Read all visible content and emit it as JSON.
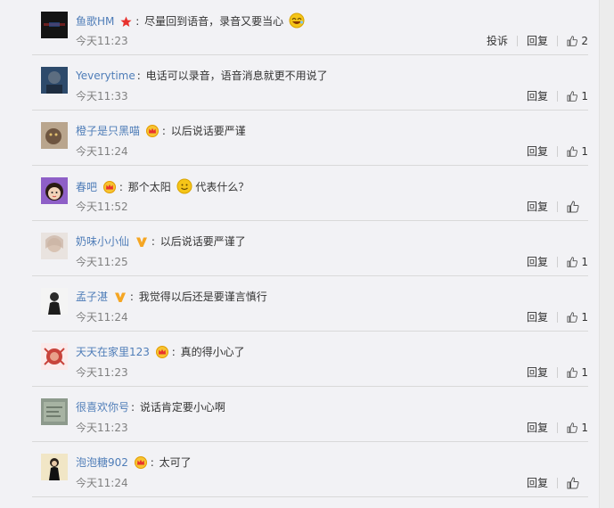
{
  "colors": {
    "username": "#4f7db8",
    "time": "#808080",
    "divider": "#d9d9d9",
    "background": "#f2f2f5"
  },
  "actions": {
    "report": "投诉",
    "reply": "回复"
  },
  "comments": [
    {
      "user": "鱼歌HM",
      "text": "尽量回到语音，录音又要当心",
      "time": "今天11:23",
      "likes": "2",
      "badge": "star-icon",
      "emoji": "laugh-emoji-icon",
      "report": true
    },
    {
      "user": "Yeverytime",
      "text": "电话可以录音，语音消息就更不用说了",
      "time": "今天11:33",
      "likes": "1"
    },
    {
      "user": "橙子是只黑喵",
      "text": "以后说话要严谨",
      "time": "今天11:24",
      "likes": "1",
      "badge": "crown-icon"
    },
    {
      "user": "春吧",
      "text": "那个太阳",
      "text2": "代表什么？",
      "time": "今天11:52",
      "likes": "",
      "badge": "crown-icon",
      "emoji": "smile-emoji-icon"
    },
    {
      "user": "奶味小小仙",
      "text": "以后说话要严谨了",
      "time": "今天11:25",
      "likes": "1",
      "badge": "verified-v-icon"
    },
    {
      "user": "孟子湛",
      "text": "我觉得以后还是要谨言慎行",
      "time": "今天11:24",
      "likes": "1",
      "badge": "verified-v-icon"
    },
    {
      "user": "天天在家里123",
      "text": "真的得小心了",
      "time": "今天11:23",
      "likes": "1",
      "badge": "crown-icon"
    },
    {
      "user": "很喜欢你号",
      "text": "说话肯定要小心啊",
      "time": "今天11:23",
      "likes": "1"
    },
    {
      "user": "泡泡糖902",
      "text": "太可了",
      "time": "今天11:24",
      "likes": "",
      "badge": "crown-icon"
    }
  ]
}
